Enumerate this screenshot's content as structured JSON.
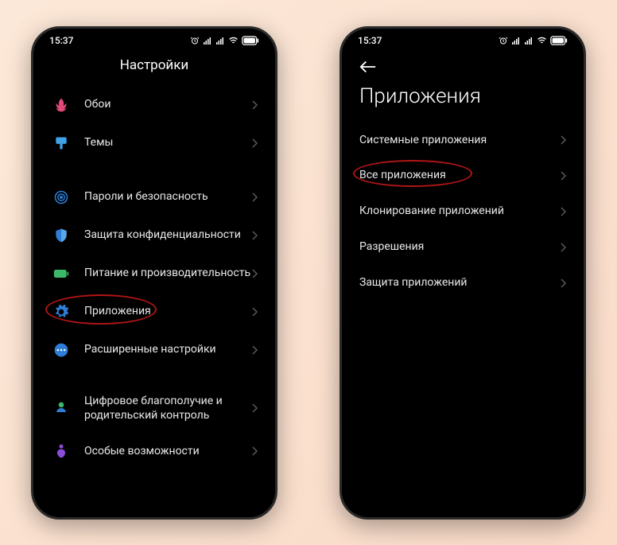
{
  "status": {
    "time": "15:37"
  },
  "screen1": {
    "title": "Настройки",
    "items": [
      {
        "label": "Обои"
      },
      {
        "label": "Темы"
      },
      {
        "label": "Пароли и безопасность"
      },
      {
        "label": "Защита конфиденциальности"
      },
      {
        "label": "Питание и производительность"
      },
      {
        "label": "Приложения"
      },
      {
        "label": "Расширенные настройки"
      },
      {
        "label": "Цифровое благополучие и родительский контроль"
      },
      {
        "label": "Особые возможности"
      }
    ]
  },
  "screen2": {
    "title": "Приложения",
    "items": [
      {
        "label": "Системные приложения"
      },
      {
        "label": "Все приложения"
      },
      {
        "label": "Клонирование приложений"
      },
      {
        "label": "Разрешения"
      },
      {
        "label": "Защита приложений"
      }
    ]
  }
}
